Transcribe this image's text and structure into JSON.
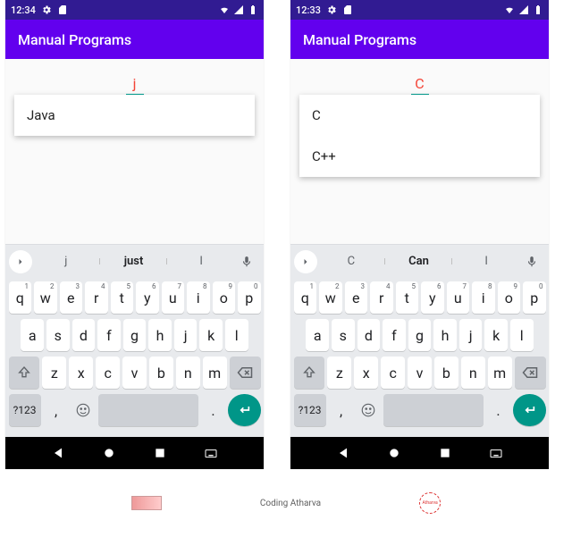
{
  "phones": [
    {
      "status": {
        "time": "12:34"
      },
      "appbar": {
        "title": "Manual Programs"
      },
      "input": {
        "value": "j"
      },
      "dropdown": [
        "Java"
      ],
      "suggestions": {
        "items": [
          "j",
          "just",
          "I"
        ]
      }
    },
    {
      "status": {
        "time": "12:33"
      },
      "appbar": {
        "title": "Manual Programs"
      },
      "input": {
        "value": "C"
      },
      "dropdown": [
        "C",
        "C++"
      ],
      "suggestions": {
        "items": [
          "C",
          "Can",
          "I"
        ]
      }
    }
  ],
  "keyboard": {
    "row1": [
      {
        "k": "q",
        "n": "1"
      },
      {
        "k": "w",
        "n": "2"
      },
      {
        "k": "e",
        "n": "3"
      },
      {
        "k": "r",
        "n": "4"
      },
      {
        "k": "t",
        "n": "5"
      },
      {
        "k": "y",
        "n": "6"
      },
      {
        "k": "u",
        "n": "7"
      },
      {
        "k": "i",
        "n": "8"
      },
      {
        "k": "o",
        "n": "9"
      },
      {
        "k": "p",
        "n": "0"
      }
    ],
    "row2": [
      "a",
      "s",
      "d",
      "f",
      "g",
      "h",
      "j",
      "k",
      "l"
    ],
    "row3": [
      "z",
      "x",
      "c",
      "v",
      "b",
      "n",
      "m"
    ],
    "sym": "?123",
    "comma": ",",
    "period": "."
  },
  "footer": {
    "text": "Coding Atharva"
  }
}
